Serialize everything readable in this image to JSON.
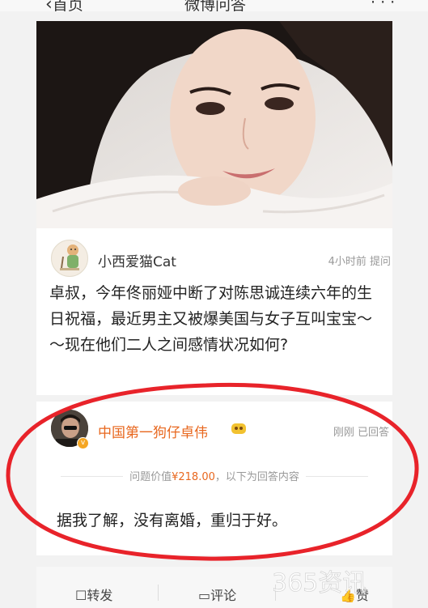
{
  "nav": {
    "back_label": "首页",
    "title": "微博问答"
  },
  "question": {
    "asker_name": "小西爱猫Cat",
    "asker_meta": "4小时前 提问",
    "text": "卓叔，今年佟丽娅中断了对陈思诚连续六年的生日祝福，最近男主又被爆美国与女子互叫宝宝～～现在他们二人之间感情状况如何?"
  },
  "answer": {
    "answerer_name": "中国第一狗仔卓伟",
    "answerer_meta": "刚刚 已回答",
    "value_prefix": "问题价值",
    "value_price": "¥218.00",
    "value_suffix": "，以下为回答内容",
    "text": "据我了解，没有离婚，重归于好。"
  },
  "footer": {
    "repost": "转发",
    "comment": "评论",
    "like": "赞"
  },
  "watermark": {
    "text": "365资讯"
  },
  "colors": {
    "accent_orange": "#e8671e",
    "annotation_red": "#e8232a"
  }
}
